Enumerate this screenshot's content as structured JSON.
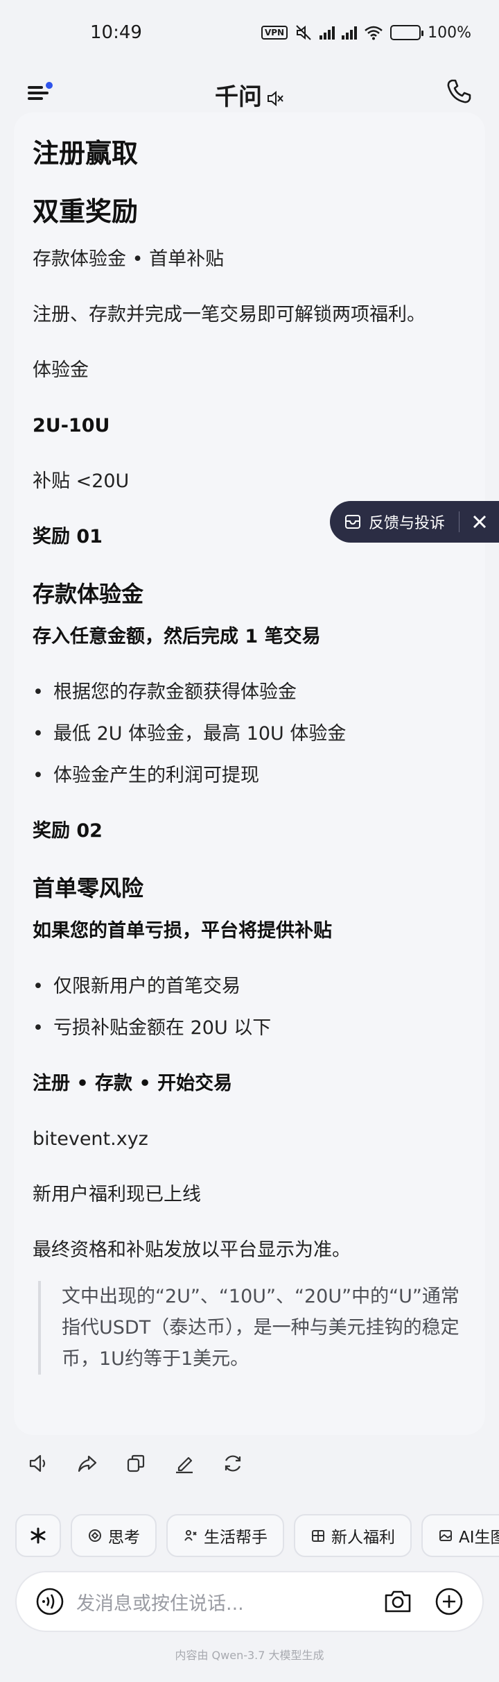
{
  "status_bar": {
    "time": "10:49",
    "vpn": "VPN",
    "battery": "100%"
  },
  "header": {
    "title": "千问"
  },
  "message": {
    "title_line1": "注册赢取",
    "title_line2": "双重奖励",
    "subtitle": "存款体验金 • 首单补贴",
    "intro": "注册、存款并完成一笔交易即可解锁两项福利。",
    "label_trial": "体验金",
    "trial_range": "2U-10U",
    "subsidy_line": "补贴 <20U",
    "reward1_label": "奖励 01",
    "reward1_title": "存款体验金",
    "reward1_desc": "存入任意金额，然后完成 1 笔交易",
    "reward1_bullets": [
      "根据您的存款金额获得体验金",
      "最低 2U 体验金，最高 10U 体验金",
      "体验金产生的利润可提现"
    ],
    "reward2_label": "奖励 02",
    "reward2_title": "首单零风险",
    "reward2_desc": "如果您的首单亏损，平台将提供补贴",
    "reward2_bullets": [
      "仅限新用户的首笔交易",
      "亏损补贴金额在 20U 以下"
    ],
    "cta": "注册 • 存款 • 开始交易",
    "domain": "bitevent.xyz",
    "live_note": "新用户福利现已上线",
    "final_note": "最终资格和补贴发放以平台显示为准。",
    "quote": "文中出现的“2U”、“10U”、“20U”中的“U”通常指代USDT（泰达币），是一种与美元挂钩的稳定币，1U约等于1美元。"
  },
  "feedback": {
    "label": "反馈与投诉"
  },
  "chips": [
    {
      "label": "思考",
      "icon": "think-icon"
    },
    {
      "label": "生活帮手",
      "icon": "life-helper-icon"
    },
    {
      "label": "新人福利",
      "icon": "gift-icon"
    },
    {
      "label": "AI生图",
      "icon": "image-icon"
    }
  ],
  "input": {
    "placeholder": "发消息或按住说话..."
  },
  "footer": {
    "note": "内容由 Qwen-3.7 大模型生成"
  },
  "colors": {
    "accent_dot": "#2f54eb",
    "battery_green": "#37c35a",
    "feedback_bg": "#2b2d44"
  }
}
